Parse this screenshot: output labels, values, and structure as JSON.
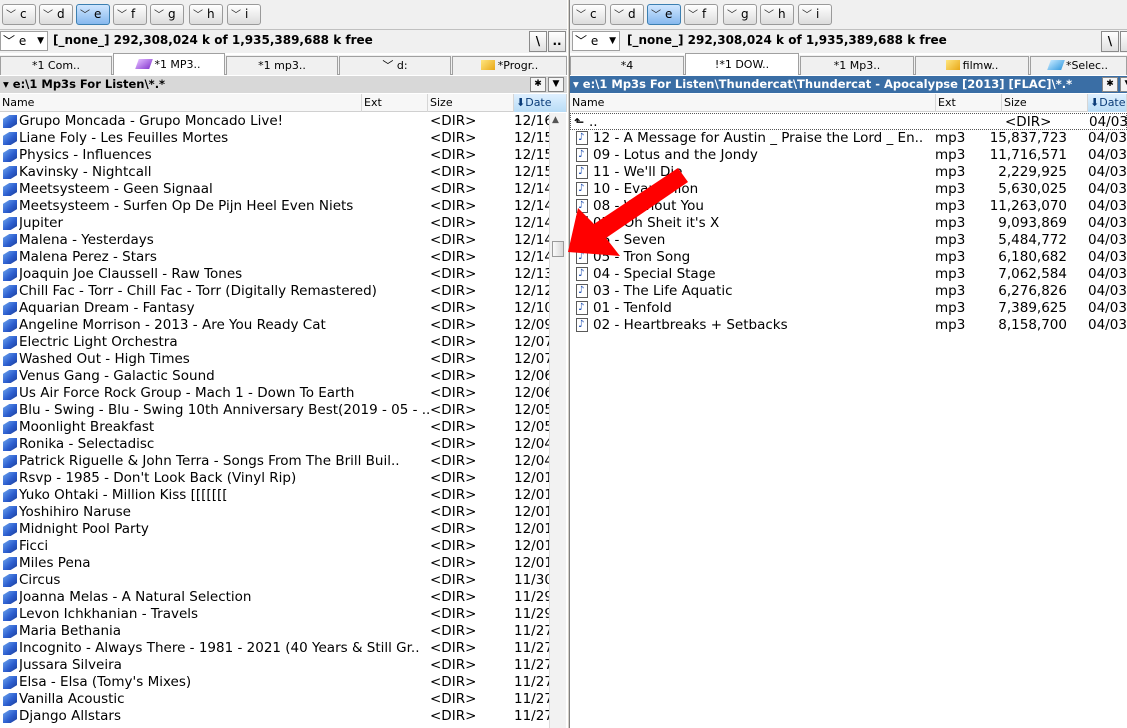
{
  "left": {
    "drives": [
      {
        "label": "c",
        "active": false
      },
      {
        "label": "d",
        "active": false
      },
      {
        "label": "e",
        "active": true
      },
      {
        "label": "f",
        "active": false
      },
      {
        "label": "g",
        "active": false
      },
      {
        "label": "h",
        "active": false
      },
      {
        "label": "i",
        "active": false
      }
    ],
    "drive_select": "e",
    "free_space": "[_none_]  292,308,024 k of 1,935,389,688 k free",
    "root_btn": "\\",
    "up_btn": "..",
    "tabs": [
      {
        "label": "*1 Com..",
        "icon": "none"
      },
      {
        "label": "*1 MP3..",
        "icon": "purple-pen-icon",
        "active": true
      },
      {
        "label": "*1 mp3..",
        "icon": "none"
      },
      {
        "label": "d:",
        "icon": "drive-chevron-icon"
      },
      {
        "label": "*Progr..",
        "icon": "yellow-folder-icon"
      }
    ],
    "path": "e:\\1 Mp3s For Listen\\*.*",
    "columns": {
      "name": "Name",
      "ext": "Ext",
      "size": "Size",
      "date": "Date"
    },
    "rows": [
      {
        "name": "Grupo Moncada - Grupo Moncado Live!",
        "size": "<DIR>",
        "date": "12/16"
      },
      {
        "name": "Liane Foly - Les Feuilles Mortes",
        "size": "<DIR>",
        "date": "12/15"
      },
      {
        "name": "Physics - Influences",
        "size": "<DIR>",
        "date": "12/15"
      },
      {
        "name": "Kavinsky - Nightcall",
        "size": "<DIR>",
        "date": "12/15"
      },
      {
        "name": "Meetsysteem - Geen Signaal",
        "size": "<DIR>",
        "date": "12/14"
      },
      {
        "name": "Meetsysteem - Surfen Op De Pijn Heel Even Niets",
        "size": "<DIR>",
        "date": "12/14"
      },
      {
        "name": "Jupiter",
        "size": "<DIR>",
        "date": "12/14"
      },
      {
        "name": "Malena - Yesterdays",
        "size": "<DIR>",
        "date": "12/14"
      },
      {
        "name": "Malena Perez - Stars",
        "size": "<DIR>",
        "date": "12/14"
      },
      {
        "name": "Joaquin Joe Claussell - Raw Tones",
        "size": "<DIR>",
        "date": "12/13"
      },
      {
        "name": "Chill Fac - Torr - Chill Fac - Torr (Digitally Remastered)",
        "size": "<DIR>",
        "date": "12/12"
      },
      {
        "name": "Aquarian Dream - Fantasy",
        "size": "<DIR>",
        "date": "12/10"
      },
      {
        "name": "Angeline Morrison - 2013 - Are You Ready Cat",
        "size": "<DIR>",
        "date": "12/09"
      },
      {
        "name": "Electric Light Orchestra",
        "size": "<DIR>",
        "date": "12/07"
      },
      {
        "name": "Washed Out - High Times",
        "size": "<DIR>",
        "date": "12/07"
      },
      {
        "name": "Venus Gang - Galactic Sound",
        "size": "<DIR>",
        "date": "12/06"
      },
      {
        "name": "Us Air Force Rock Group - Mach 1 - Down To Earth",
        "size": "<DIR>",
        "date": "12/06"
      },
      {
        "name": "Blu - Swing - Blu - Swing 10th Anniversary Best(2019 - 05 - ..",
        "size": "<DIR>",
        "date": "12/05"
      },
      {
        "name": "Moonlight Breakfast",
        "size": "<DIR>",
        "date": "12/05"
      },
      {
        "name": "Ronika - Selectadisc",
        "size": "<DIR>",
        "date": "12/04"
      },
      {
        "name": "Patrick Riguelle & John Terra - Songs From The Brill Buil..",
        "size": "<DIR>",
        "date": "12/04"
      },
      {
        "name": "Rsvp - 1985 - Don't Look Back (Vinyl Rip)",
        "size": "<DIR>",
        "date": "12/01"
      },
      {
        "name": "Yuko Ohtaki - Million Kiss [[[[[[[",
        "size": "<DIR>",
        "date": "12/01"
      },
      {
        "name": "Yoshihiro Naruse",
        "size": "<DIR>",
        "date": "12/01"
      },
      {
        "name": "Midnight Pool Party",
        "size": "<DIR>",
        "date": "12/01"
      },
      {
        "name": "Ficci",
        "size": "<DIR>",
        "date": "12/01"
      },
      {
        "name": "Miles Pena",
        "size": "<DIR>",
        "date": "12/01"
      },
      {
        "name": "Circus",
        "size": "<DIR>",
        "date": "11/30"
      },
      {
        "name": "Joanna Melas - A Natural Selection",
        "size": "<DIR>",
        "date": "11/29"
      },
      {
        "name": "Levon Ichkhanian - Travels",
        "size": "<DIR>",
        "date": "11/29"
      },
      {
        "name": "Maria Bethania",
        "size": "<DIR>",
        "date": "11/27"
      },
      {
        "name": "Incognito - Always There - 1981 - 2021 (40 Years & Still Gr..",
        "size": "<DIR>",
        "date": "11/27"
      },
      {
        "name": "Jussara Silveira",
        "size": "<DIR>",
        "date": "11/27"
      },
      {
        "name": "Elsa - Elsa (Tomy's Mixes)",
        "size": "<DIR>",
        "date": "11/27"
      },
      {
        "name": "Vanilla Acoustic",
        "size": "<DIR>",
        "date": "11/27"
      },
      {
        "name": "Django Allstars",
        "size": "<DIR>",
        "date": "11/27"
      }
    ]
  },
  "right": {
    "drives": [
      {
        "label": "c",
        "active": false
      },
      {
        "label": "d",
        "active": false
      },
      {
        "label": "e",
        "active": true
      },
      {
        "label": "f",
        "active": false
      },
      {
        "label": "g",
        "active": false
      },
      {
        "label": "h",
        "active": false
      },
      {
        "label": "i",
        "active": false
      }
    ],
    "drive_select": "e",
    "free_space": "[_none_]  292,308,024 k of 1,935,389,688 k free",
    "root_btn": "\\",
    "tabs": [
      {
        "label": "*4",
        "icon": "none"
      },
      {
        "label": "!*1 DOW..",
        "icon": "none",
        "active": true
      },
      {
        "label": "*1 Mp3..",
        "icon": "none"
      },
      {
        "label": "filmw..",
        "icon": "yellow-folder-icon"
      },
      {
        "label": "*Selec..",
        "icon": "blue-pen-icon"
      }
    ],
    "path": "e:\\1 Mp3s For Listen\\Thundercat\\Thundercat - Apocalypse [2013] [FLAC]\\*.*",
    "columns": {
      "name": "Name",
      "ext": "Ext",
      "size": "Size",
      "date": "Date"
    },
    "up_row": {
      "name": "..",
      "size": "<DIR>",
      "date": "04/03/"
    },
    "rows": [
      {
        "name": "12 - A Message for Austin _ Praise the Lord _ En..",
        "ext": "mp3",
        "size": "15,837,723",
        "date": "04/03/"
      },
      {
        "name": "09 - Lotus and the Jondy",
        "ext": "mp3",
        "size": "11,716,571",
        "date": "04/03/"
      },
      {
        "name": "11 - We'll Die",
        "ext": "mp3",
        "size": "2,229,925",
        "date": "04/03/"
      },
      {
        "name": "10 - Evangelion",
        "ext": "mp3",
        "size": "5,630,025",
        "date": "04/03/"
      },
      {
        "name": "08 - Without You",
        "ext": "mp3",
        "size": "11,263,070",
        "date": "04/03/"
      },
      {
        "name": "07 - Oh Sheit it's X",
        "ext": "mp3",
        "size": "9,093,869",
        "date": "04/03/"
      },
      {
        "name": "06 - Seven",
        "ext": "mp3",
        "size": "5,484,772",
        "date": "04/03/"
      },
      {
        "name": "05 - Tron Song",
        "ext": "mp3",
        "size": "6,180,682",
        "date": "04/03/"
      },
      {
        "name": "04 - Special Stage",
        "ext": "mp3",
        "size": "7,062,584",
        "date": "04/03/"
      },
      {
        "name": "03 - The Life Aquatic",
        "ext": "mp3",
        "size": "6,276,826",
        "date": "04/03/"
      },
      {
        "name": "01 - Tenfold",
        "ext": "mp3",
        "size": "7,389,625",
        "date": "04/03/"
      },
      {
        "name": "02 - Heartbreaks + Setbacks",
        "ext": "mp3",
        "size": "8,158,700",
        "date": "04/03/"
      }
    ]
  },
  "colors": {
    "active_path_bg": "#3a6ea5",
    "inactive_path_bg": "#d8d8d8",
    "annotation_arrow": "#ff0000",
    "folder_icon": "#2d5fd0"
  }
}
